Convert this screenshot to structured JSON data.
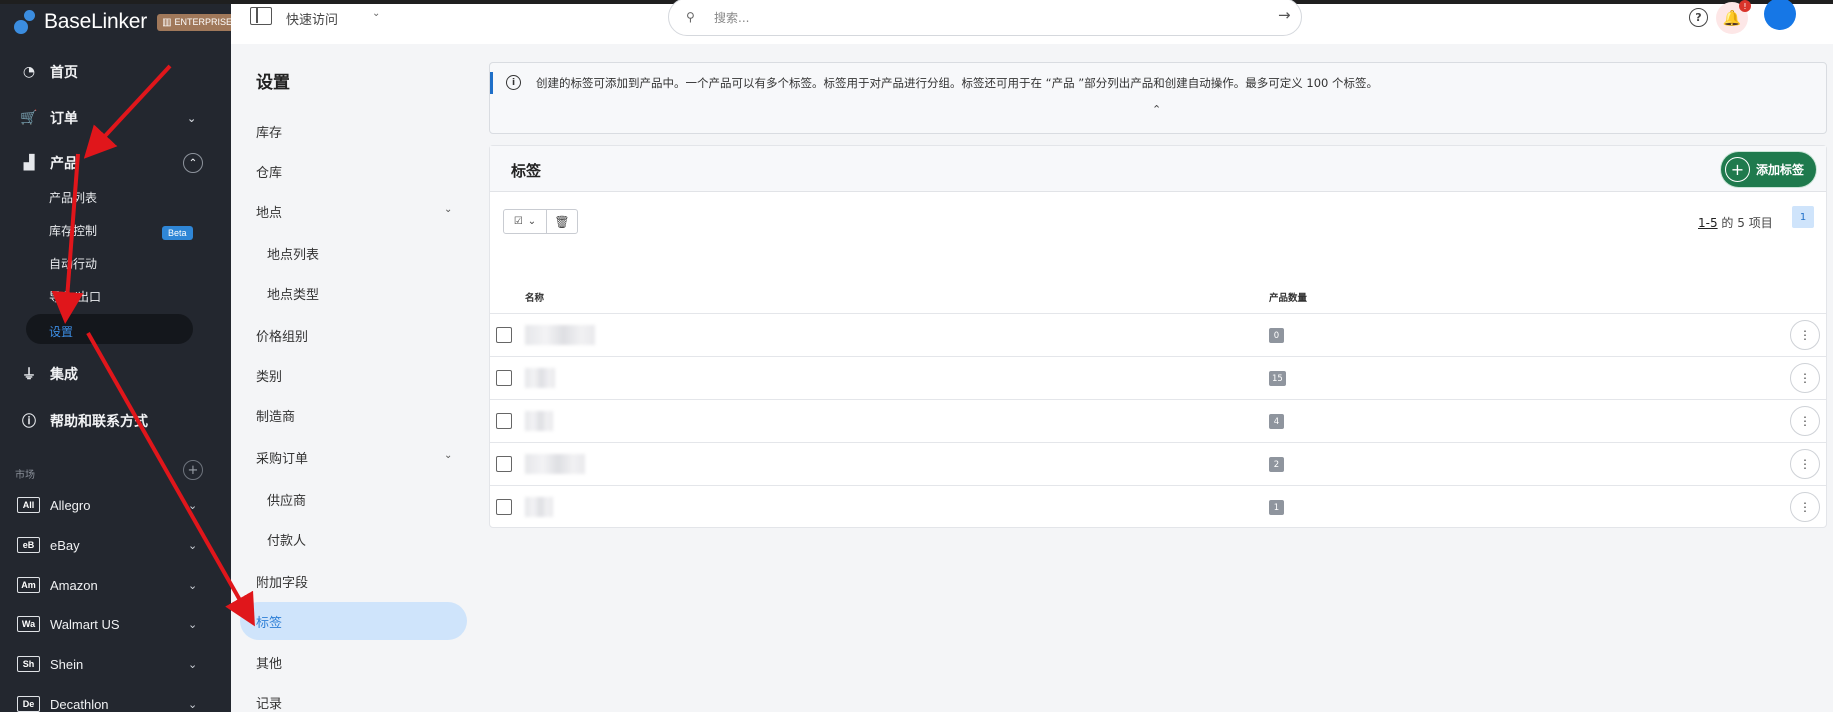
{
  "brand": {
    "name": "BaseLinker",
    "badge": "ENTERPRISE"
  },
  "sidebar": {
    "items": [
      {
        "label": "首页"
      },
      {
        "label": "订单"
      },
      {
        "label": "产品"
      },
      {
        "label": "集成"
      },
      {
        "label": "帮助和联系方式"
      }
    ],
    "products_sub": [
      {
        "label": "产品列表"
      },
      {
        "label": "库存控制",
        "badge": "Beta"
      },
      {
        "label": "自动行动"
      },
      {
        "label": "导入/出口"
      },
      {
        "label": "设置"
      }
    ],
    "section_label": "市场",
    "marketplaces": [
      {
        "abbr": "All",
        "label": "Allegro"
      },
      {
        "abbr": "eB",
        "label": "eBay"
      },
      {
        "abbr": "Am",
        "label": "Amazon"
      },
      {
        "abbr": "Wa",
        "label": "Walmart US"
      },
      {
        "abbr": "Sh",
        "label": "Shein"
      },
      {
        "abbr": "De",
        "label": "Decathlon"
      }
    ]
  },
  "topbar": {
    "quick_access": "快速访问",
    "search_placeholder": "搜索...",
    "notification_count": "!"
  },
  "settings_nav": {
    "title": "设置",
    "items": [
      {
        "label": "库存"
      },
      {
        "label": "仓库"
      },
      {
        "label": "地点"
      },
      {
        "label": "地点列表"
      },
      {
        "label": "地点类型"
      },
      {
        "label": "价格组别"
      },
      {
        "label": "类别"
      },
      {
        "label": "制造商"
      },
      {
        "label": "采购订单"
      },
      {
        "label": "供应商"
      },
      {
        "label": "付款人"
      },
      {
        "label": "附加字段"
      },
      {
        "label": "标签"
      },
      {
        "label": "其他"
      },
      {
        "label": "记录"
      }
    ]
  },
  "info_box": {
    "text": "创建的标签可添加到产品中。一个产品可以有多个标签。标签用于对产品进行分组。标签还可用于在 “产品 ”部分列出产品和创建自动操作。最多可定义 100 个标签。"
  },
  "tags_card": {
    "title": "标签",
    "add_button": "添加标签",
    "pager_range": "1-5",
    "pager_rest": " 的 5 项目",
    "page": "1",
    "columns": {
      "name": "名称",
      "count": "产品数量"
    },
    "rows": [
      {
        "count": "0"
      },
      {
        "count": "15"
      },
      {
        "count": "4"
      },
      {
        "count": "2"
      },
      {
        "count": "1"
      }
    ]
  },
  "colors": {
    "sidebar_bg": "#23272f",
    "accent": "#2e7fd6",
    "add_button": "#1f7a4d",
    "arrow": "#e0161b"
  }
}
